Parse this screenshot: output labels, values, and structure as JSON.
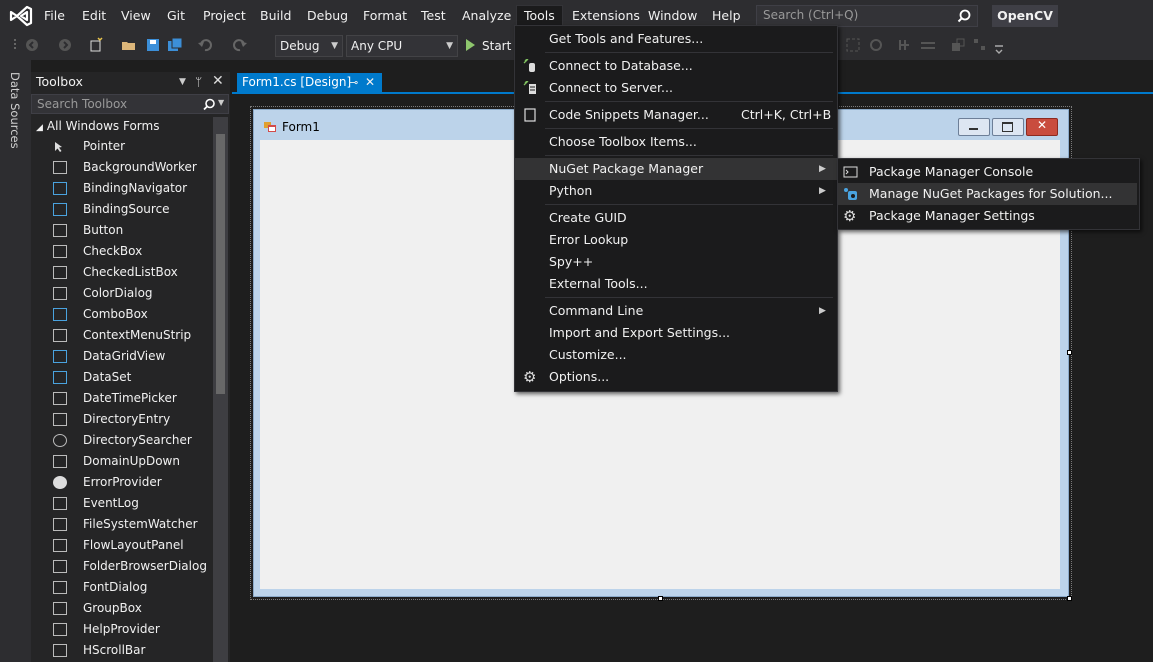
{
  "menubar": {
    "items": [
      "File",
      "Edit",
      "View",
      "Git",
      "Project",
      "Build",
      "Debug",
      "Format",
      "Test",
      "Analyze",
      "Tools",
      "Extensions",
      "Window",
      "Help"
    ],
    "search_placeholder": "Search (Ctrl+Q)",
    "solution_name": "OpenCV"
  },
  "toolbar": {
    "config": "Debug",
    "platform": "Any CPU",
    "start_label": "Start"
  },
  "side_tab": "Data Sources",
  "toolbox": {
    "title": "Toolbox",
    "search_placeholder": "Search Toolbox",
    "group": "All Windows Forms",
    "items": [
      "Pointer",
      "BackgroundWorker",
      "BindingNavigator",
      "BindingSource",
      "Button",
      "CheckBox",
      "CheckedListBox",
      "ColorDialog",
      "ComboBox",
      "ContextMenuStrip",
      "DataGridView",
      "DataSet",
      "DateTimePicker",
      "DirectoryEntry",
      "DirectorySearcher",
      "DomainUpDown",
      "ErrorProvider",
      "EventLog",
      "FileSystemWatcher",
      "FlowLayoutPanel",
      "FolderBrowserDialog",
      "FontDialog",
      "GroupBox",
      "HelpProvider",
      "HScrollBar"
    ]
  },
  "document_tab": {
    "title": "Form1.cs [Design]"
  },
  "form": {
    "title": "Form1"
  },
  "tools_menu": {
    "items": [
      {
        "label": "Get Tools and Features...",
        "shortcut": ""
      },
      {
        "label": "Connect to Database...",
        "shortcut": ""
      },
      {
        "label": "Connect to Server...",
        "shortcut": ""
      },
      {
        "label": "Code Snippets Manager...",
        "shortcut": "Ctrl+K, Ctrl+B"
      },
      {
        "label": "Choose Toolbox Items...",
        "shortcut": ""
      },
      {
        "label": "NuGet Package Manager",
        "shortcut": ""
      },
      {
        "label": "Python",
        "shortcut": ""
      },
      {
        "label": "Create GUID",
        "shortcut": ""
      },
      {
        "label": "Error Lookup",
        "shortcut": ""
      },
      {
        "label": "Spy++",
        "shortcut": ""
      },
      {
        "label": "External Tools...",
        "shortcut": ""
      },
      {
        "label": "Command Line",
        "shortcut": ""
      },
      {
        "label": "Import and Export Settings...",
        "shortcut": ""
      },
      {
        "label": "Customize...",
        "shortcut": ""
      },
      {
        "label": "Options...",
        "shortcut": ""
      }
    ]
  },
  "nuget_submenu": {
    "items": [
      "Package Manager Console",
      "Manage NuGet Packages for Solution...",
      "Package Manager Settings"
    ]
  },
  "colors": {
    "accent": "#007acc",
    "menu_bg": "#1b1b1c",
    "chrome_bg": "#2d2d30"
  }
}
